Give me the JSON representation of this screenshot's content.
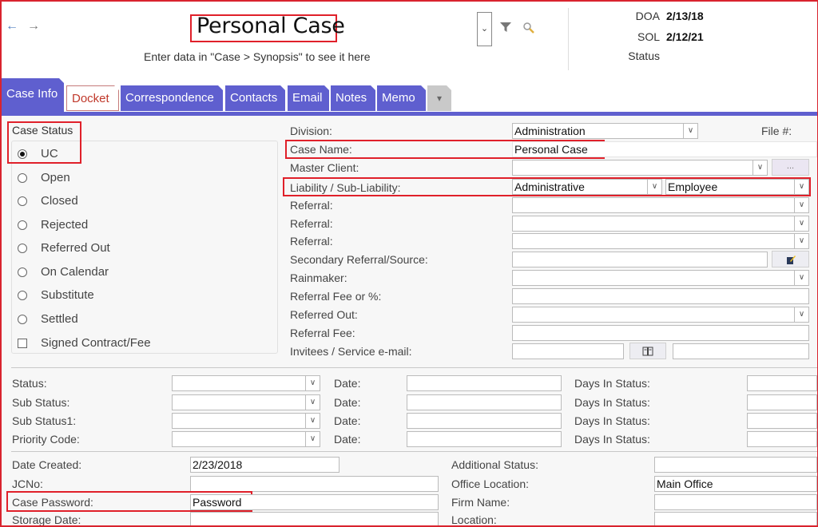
{
  "header": {
    "title": "Personal Case",
    "synopsis": "Enter data in \"Case > Synopsis\" to see it here",
    "back_icon": "arrow-left-icon",
    "forward_icon": "arrow-right-icon",
    "dropdown_glyph": "⌄",
    "doa_label": "DOA",
    "doa_value": "2/13/18",
    "sol_label": "SOL",
    "sol_value": "2/12/21",
    "status_label": "Status"
  },
  "tabs": [
    {
      "label": "Case Info",
      "active": true
    },
    {
      "label": "Docket"
    },
    {
      "label": "Correspondence"
    },
    {
      "label": "Contacts"
    },
    {
      "label": "Email"
    },
    {
      "label": "Notes"
    },
    {
      "label": "Memo"
    },
    {
      "label": "▾"
    }
  ],
  "case_status": {
    "title": "Case Status",
    "options": [
      {
        "label": "UC",
        "selected": true
      },
      {
        "label": "Open"
      },
      {
        "label": "Closed"
      },
      {
        "label": "Rejected"
      },
      {
        "label": "Referred Out"
      },
      {
        "label": "On Calendar"
      },
      {
        "label": "Substitute"
      },
      {
        "label": "Settled"
      }
    ],
    "signed_contract_label": "Signed Contract/Fee",
    "signed_contract_checked": false
  },
  "details": {
    "division_label": "Division:",
    "division_value": "Administration",
    "file_no_label": "File #:",
    "case_name_label": "Case Name:",
    "case_name_value": "Personal Case",
    "master_client_label": "Master Client:",
    "master_client_value": "",
    "master_client_button": "...",
    "liability_label": "Liability / Sub-Liability:",
    "liability_value": "Administrative",
    "sub_liability_value": "Employee",
    "referral_label": "Referral:",
    "secondary_referral_label": "Secondary Referral/Source:",
    "rainmaker_label": "Rainmaker:",
    "referral_fee_pct_label": "Referral Fee or %:",
    "referred_out_label": "Referred Out:",
    "referral_fee_label": "Referral Fee:",
    "invitees_label": "Invitees / Service e-mail:"
  },
  "status_rows": [
    {
      "label": "Status:",
      "date_label": "Date:",
      "days_label": "Days In Status:"
    },
    {
      "label": "Sub Status:",
      "date_label": "Date:",
      "days_label": "Days In Status:"
    },
    {
      "label": "Sub Status1:",
      "date_label": "Date:",
      "days_label": "Days In Status:"
    },
    {
      "label": "Priority Code:",
      "date_label": "Date:",
      "days_label": "Days In Status:"
    }
  ],
  "bottom": {
    "date_created_label": "Date Created:",
    "date_created_value": "2/23/2018",
    "jcno_label": "JCNo:",
    "case_password_label": "Case Password:",
    "case_password_value": "Password",
    "storage_date_label": "Storage Date:",
    "additional_status_label": "Additional Status:",
    "office_location_label": "Office Location:",
    "office_location_value": "Main Office",
    "firm_name_label": "Firm Name:",
    "location_label": "Location:"
  },
  "colors": {
    "tab_purple": "#5f5fcf",
    "highlight_red": "#e0202a",
    "docket_red": "#c0392b"
  }
}
